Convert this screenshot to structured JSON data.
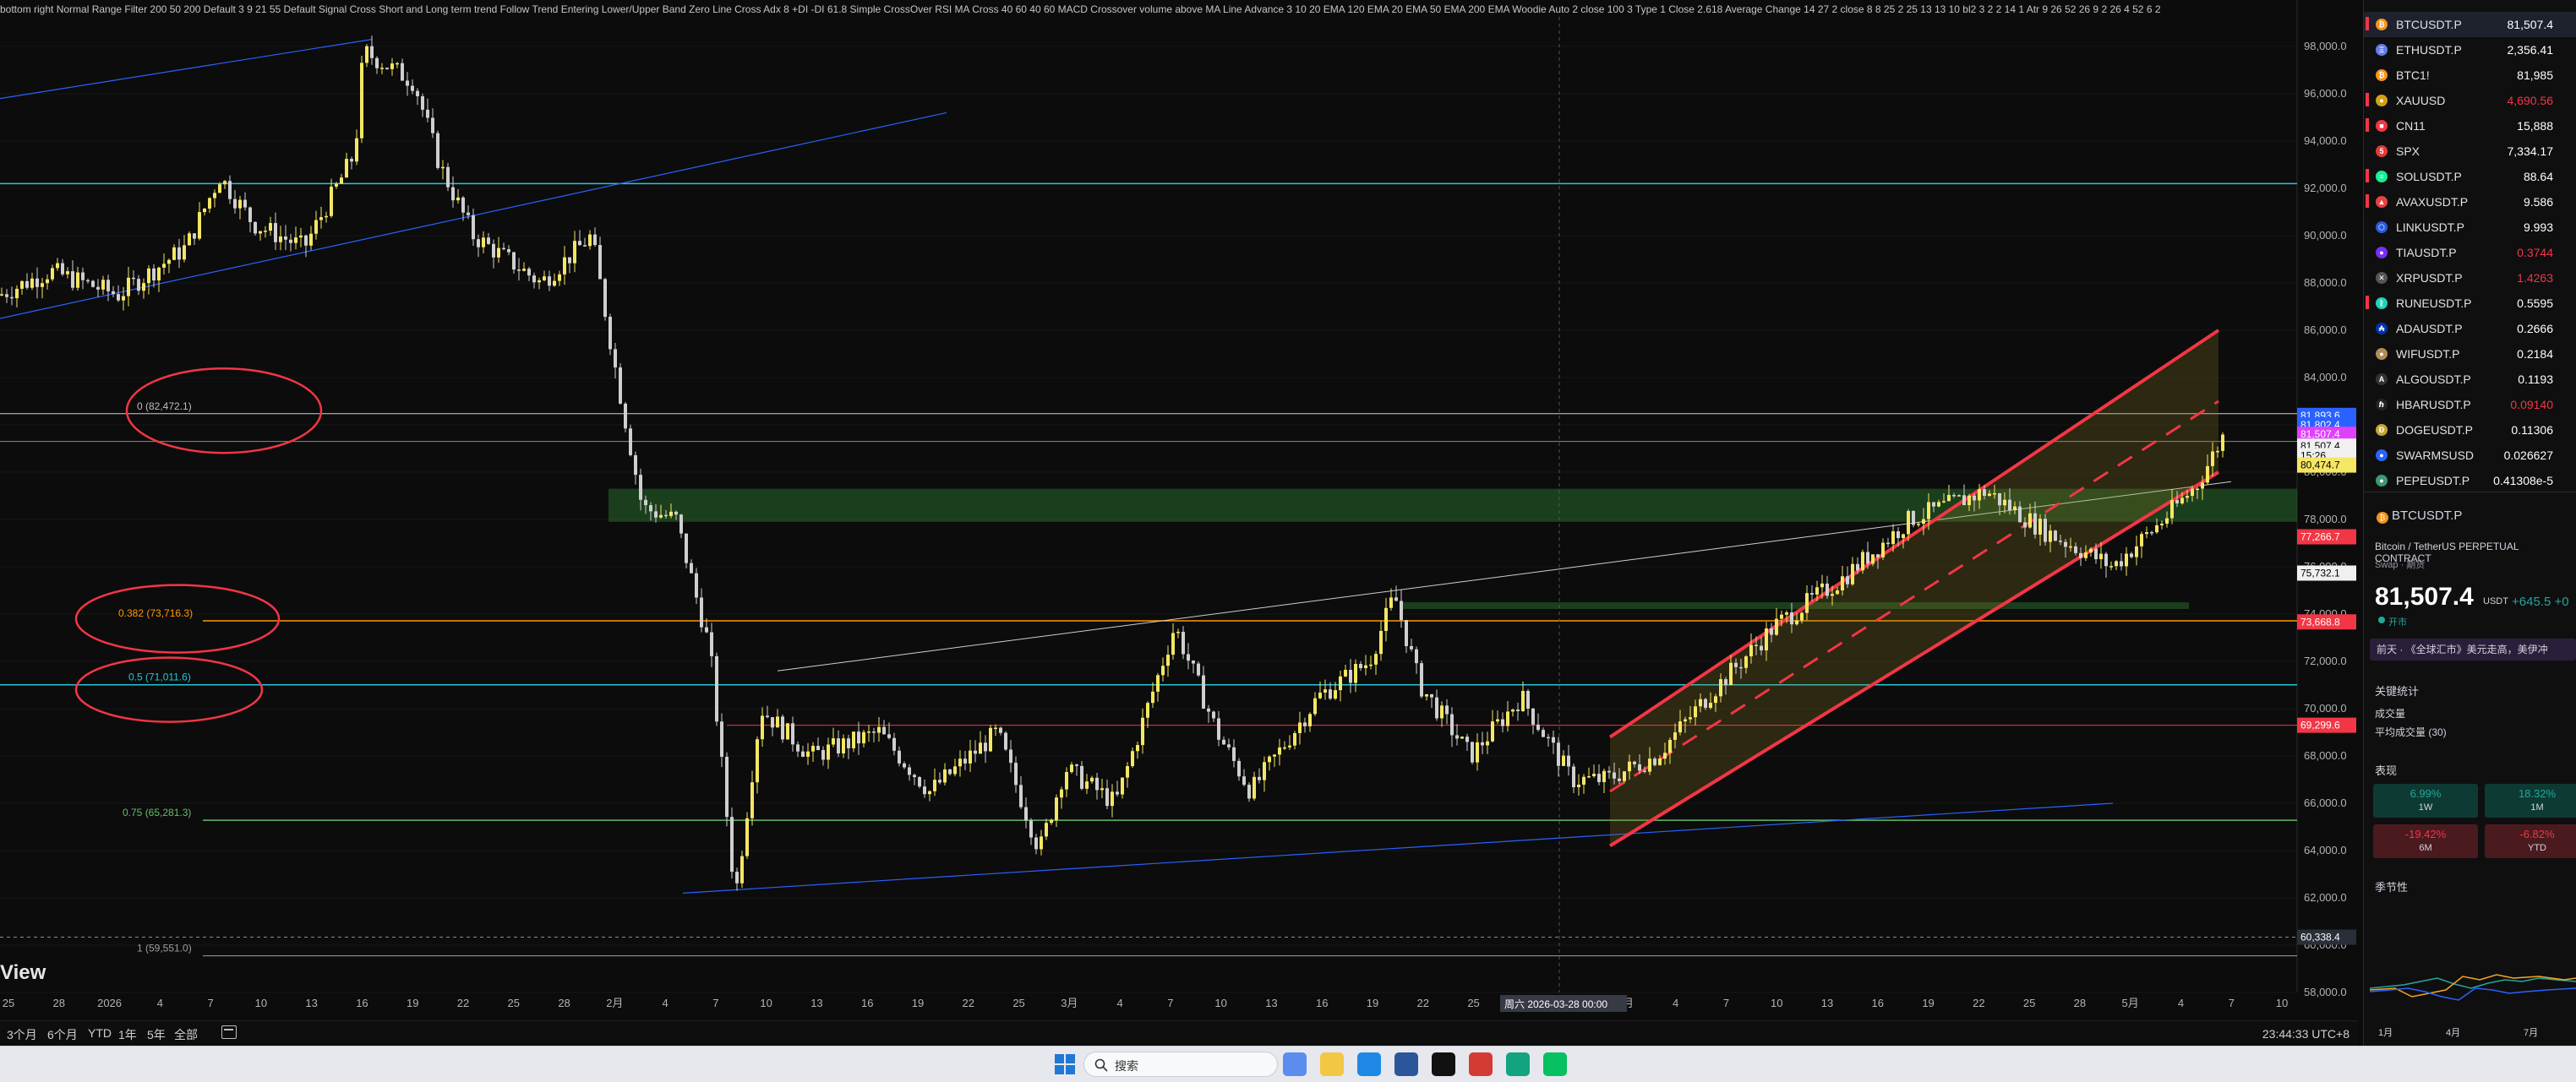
{
  "legend_text": "bottom right Normal Range Filter 200 50 200 Default 3 9 21 55 Default Signal Cross Short and Long term trend Follow Trend Entering Lower/Upper Band Zero Line Cross Adx 8 +DI -DI 61.8 Simple CrossOver RSI MA Cross 40 60 40 60 MACD Crossover volume above MA Line Advance 3 10 20 EMA 120 EMA 20 EMA 50 EMA 200 EMA Woodie Auto 2 close 100 3 Type 1 Close 2.618 Average Change 14 27 2 close 8 8 25 2 25 13 13 10 bl2 3 2 2 14 1 Atr 9 26 52 26 9 2 26 4 52 6 2",
  "brand_fragment": "View",
  "y_axis_ticks": [
    "98,000.0",
    "96,000.0",
    "94,000.0",
    "92,000.0",
    "90,000.0",
    "88,000.0",
    "86,000.0",
    "84,000.0",
    "82,000.0",
    "80,000.0",
    "78,000.0",
    "76,000.0",
    "74,000.0",
    "72,000.0",
    "70,000.0",
    "68,000.0",
    "66,000.0",
    "64,000.0",
    "62,000.0",
    "60,000.0",
    "58,000.0"
  ],
  "x_axis_ticks": [
    "25",
    "28",
    "2026",
    "4",
    "7",
    "10",
    "13",
    "16",
    "19",
    "22",
    "25",
    "28",
    "2月",
    "4",
    "7",
    "10",
    "13",
    "16",
    "19",
    "22",
    "25",
    "3月",
    "4",
    "7",
    "10",
    "13",
    "16",
    "19",
    "22",
    "25",
    "28",
    "31",
    "4月",
    "4",
    "7",
    "10",
    "13",
    "16",
    "19",
    "22",
    "25",
    "28",
    "5月",
    "4",
    "7",
    "10"
  ],
  "crosshair_label": "周六 2026-03-28  00:00",
  "fib_labels": [
    "0 (82,472.1)",
    "0.382 (73,716.3)",
    "0.5 (71,011.6)",
    "0.75 (65,281.3)",
    "1 (59,551.0)"
  ],
  "price_tags": [
    {
      "text": "81,893.6",
      "bg": "#2962ff",
      "fg": "#ffffff",
      "value": 82400
    },
    {
      "text": "81,802.4",
      "bg": "#2962ff",
      "fg": "#ffffff",
      "value": 82000
    },
    {
      "text": "81,507.4",
      "bg": "#e040fb",
      "fg": "#ffffff",
      "value": 81600
    },
    {
      "text": "81,507.4",
      "bg": "#f0f0f0",
      "fg": "#000000",
      "value": 81100
    },
    {
      "text": "15:26",
      "bg": "#f0f0f0",
      "fg": "#000000",
      "value": 80700
    },
    {
      "text": "80,474.7",
      "bg": "#f5e663",
      "fg": "#000000",
      "value": 80300
    },
    {
      "text": "77,266.7",
      "bg": "#f23645",
      "fg": "#ffffff",
      "value": 77266.7
    },
    {
      "text": "75,732.1",
      "bg": "#f0f0f0",
      "fg": "#000000",
      "value": 75732.1
    },
    {
      "text": "73,668.8",
      "bg": "#f23645",
      "fg": "#ffffff",
      "value": 73668.8
    },
    {
      "text": "69,299.6",
      "bg": "#f23645",
      "fg": "#ffffff",
      "value": 69299.6
    },
    {
      "text": "60,338.4",
      "bg": "#2a2e39",
      "fg": "#ffffff",
      "value": 60338.4
    }
  ],
  "toolbar": {
    "ranges": [
      "3个月",
      "6个月",
      "YTD",
      "1年",
      "5年",
      "全部"
    ],
    "clock": "23:44:33 UTC+8"
  },
  "watchlist": [
    {
      "symbol": "BTCUSDT.P",
      "price": "81,507.4",
      "color": "#f7931a",
      "glyph": "₿",
      "pc": "#ffffff",
      "flag": true,
      "active": true
    },
    {
      "symbol": "ETHUSDT.P",
      "price": "2,356.41",
      "color": "#627eea",
      "glyph": "Ξ",
      "pc": "#ffffff",
      "flag": false
    },
    {
      "symbol": "BTC1!",
      "price": "81,985",
      "color": "#f7931a",
      "glyph": "₿",
      "pc": "#ffffff",
      "flag": false
    },
    {
      "symbol": "XAUUSD",
      "price": "4,690.56",
      "color": "#d4a017",
      "glyph": "●",
      "pc": "#f23645",
      "flag": true
    },
    {
      "symbol": "CN11",
      "price": "15,888",
      "color": "#f23645",
      "glyph": "■",
      "pc": "#ffffff",
      "flag": true
    },
    {
      "symbol": "SPX",
      "price": "7,334.17",
      "color": "#e53935",
      "glyph": "5",
      "pc": "#ffffff",
      "flag": false
    },
    {
      "symbol": "SOLUSDT.P",
      "price": "88.64",
      "color": "#14f195",
      "glyph": "≡",
      "pc": "#ffffff",
      "flag": true
    },
    {
      "symbol": "AVAXUSDT.P",
      "price": "9.586",
      "color": "#e84142",
      "glyph": "▲",
      "pc": "#ffffff",
      "flag": true
    },
    {
      "symbol": "LINKUSDT.P",
      "price": "9.993",
      "color": "#2a5ada",
      "glyph": "⬡",
      "pc": "#ffffff",
      "flag": false
    },
    {
      "symbol": "TIAUSDT.P",
      "price": "0.3744",
      "color": "#7b2bf9",
      "glyph": "●",
      "pc": "#f23645",
      "flag": false
    },
    {
      "symbol": "XRPUSDT.P",
      "price": "1.4263",
      "color": "#555555",
      "glyph": "✕",
      "pc": "#f23645",
      "flag": false
    },
    {
      "symbol": "RUNEUSDT.P",
      "price": "0.5595",
      "color": "#1ed3b5",
      "glyph": "ᚱ",
      "pc": "#ffffff",
      "flag": true
    },
    {
      "symbol": "ADAUSDT.P",
      "price": "0.2666",
      "color": "#0033ad",
      "glyph": "₳",
      "pc": "#ffffff",
      "flag": false
    },
    {
      "symbol": "WIFUSDT.P",
      "price": "0.2184",
      "color": "#b08d57",
      "glyph": "●",
      "pc": "#ffffff",
      "flag": false
    },
    {
      "symbol": "ALGOUSDT.P",
      "price": "0.1193",
      "color": "#333333",
      "glyph": "A",
      "pc": "#ffffff",
      "flag": false
    },
    {
      "symbol": "HBARUSDT.P",
      "price": "0.09140",
      "color": "#222222",
      "glyph": "ℏ",
      "pc": "#f23645",
      "flag": false
    },
    {
      "symbol": "DOGEUSDT.P",
      "price": "0.11306",
      "color": "#c2a633",
      "glyph": "Ð",
      "pc": "#ffffff",
      "flag": false
    },
    {
      "symbol": "SWARMSUSD",
      "price": "0.026627",
      "color": "#2962ff",
      "glyph": "●",
      "pc": "#ffffff",
      "flag": false
    },
    {
      "symbol": "PEPEUSDT.P",
      "price": "0.41308e-5",
      "color": "#3d9970",
      "glyph": "●",
      "pc": "#ffffff",
      "flag": false
    }
  ],
  "detail": {
    "symbol": "BTCUSDT.P",
    "name": "Bitcoin / TetherUS PERPETUAL CONTRACT",
    "type": "Swap · 期货",
    "price": "81,507.4",
    "currency": "USDT",
    "change": "+645.5 +0",
    "status": "开市",
    "news": "前天 · 《全球汇市》美元走高，美伊冲",
    "key_stats": "关键统计",
    "volume": "成交量",
    "avg_volume": "平均成交量 (30)",
    "performance": "表现",
    "perf": [
      {
        "value": "6.99%",
        "period": "1W",
        "bg": "#0d3b34",
        "fg": "#26a69a"
      },
      {
        "value": "18.32%",
        "period": "1M",
        "bg": "#0d3b34",
        "fg": "#26a69a"
      },
      {
        "value": "-19.42%",
        "period": "6M",
        "bg": "#4a1a1f",
        "fg": "#f23645"
      },
      {
        "value": "-6.82%",
        "period": "YTD",
        "bg": "#4a1a1f",
        "fg": "#f23645"
      }
    ],
    "seasonal": "季节性",
    "season_axis": [
      "1月",
      "4月",
      "7月"
    ]
  },
  "taskbar": {
    "search_label": "搜索",
    "apps": [
      {
        "name": "copilot",
        "color": "#5a8dee"
      },
      {
        "name": "file-explorer",
        "color": "#f2c744"
      },
      {
        "name": "edge",
        "color": "#1e88e5"
      },
      {
        "name": "mail",
        "color": "#2b579a"
      },
      {
        "name": "tradingview",
        "color": "#111111"
      },
      {
        "name": "netease-music",
        "color": "#d43c33"
      },
      {
        "name": "app-teal",
        "color": "#14a37f"
      },
      {
        "name": "wechat",
        "color": "#07c160"
      }
    ]
  },
  "colors": {
    "bull": "#f5e663",
    "bear": "#cfcfcf",
    "channel": "#f23645",
    "green_zone": "#2e7d32",
    "blue_line": "#2962ff",
    "cyan_line": "#26c6da"
  }
}
